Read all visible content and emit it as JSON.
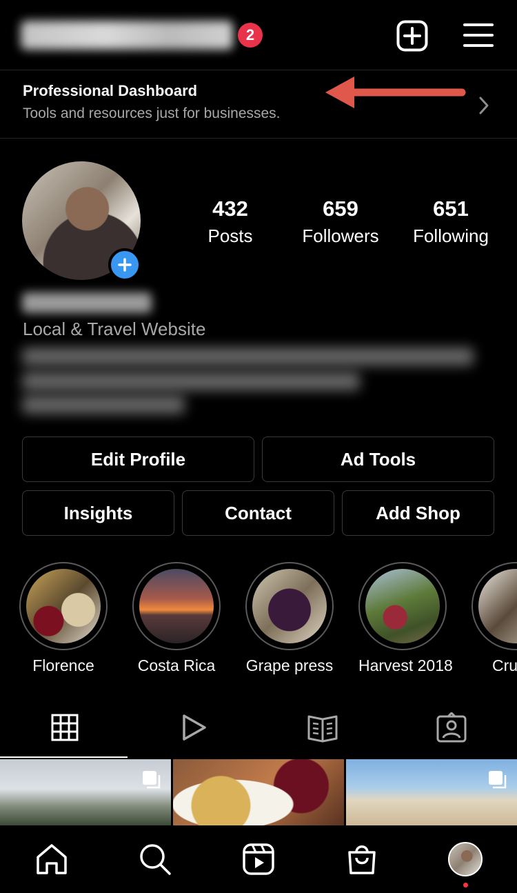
{
  "header": {
    "notification_count": "2",
    "icons": {
      "new_post": "plus-square-icon",
      "menu": "hamburger-menu-icon"
    }
  },
  "dashboard": {
    "title": "Professional Dashboard",
    "subtitle": "Tools and resources just for businesses."
  },
  "profile": {
    "stats": [
      {
        "value": "432",
        "label": "Posts"
      },
      {
        "value": "659",
        "label": "Followers"
      },
      {
        "value": "651",
        "label": "Following"
      }
    ],
    "category": "Local & Travel Website"
  },
  "actions": {
    "edit_profile": "Edit Profile",
    "ad_tools": "Ad Tools",
    "insights": "Insights",
    "contact": "Contact",
    "add_shop": "Add Shop"
  },
  "highlights": [
    {
      "label": "Florence"
    },
    {
      "label": "Costa Rica"
    },
    {
      "label": "Grape press"
    },
    {
      "label": "Harvest 2018"
    },
    {
      "label": "Cru"
    }
  ],
  "tabs": {
    "active": "grid",
    "icons": [
      "grid-icon",
      "reels-icon",
      "guides-icon",
      "tagged-icon"
    ]
  },
  "bottom_nav": {
    "icons": [
      "home-icon",
      "search-icon",
      "reels-icon",
      "shop-icon",
      "profile-avatar"
    ]
  },
  "colors": {
    "background": "#000000",
    "badge": "#e8334a",
    "accent_blue": "#3897f0",
    "annotation_arrow": "#e0574c",
    "secondary_text": "#a8a8a8"
  }
}
